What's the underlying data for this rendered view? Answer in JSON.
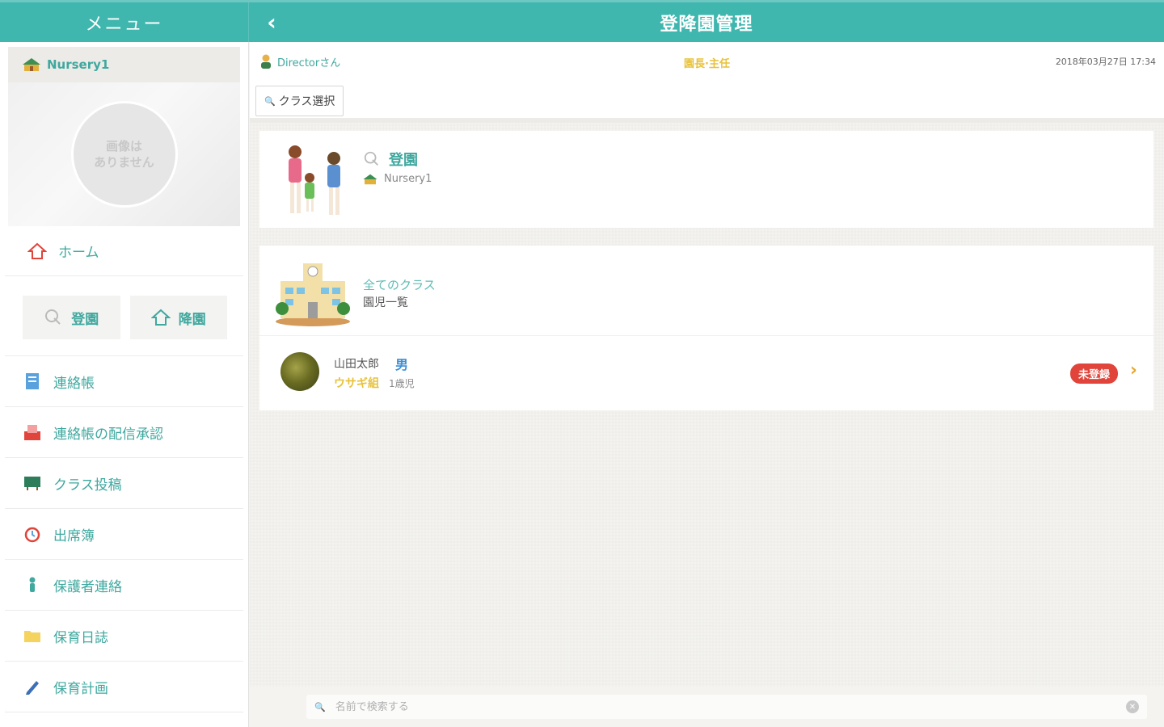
{
  "header": {
    "menu_title": "メニュー",
    "page_title": "登降園管理",
    "back_icon": "chevron-left-icon"
  },
  "sidebar": {
    "nursery_name": "Nursery1",
    "no_image_text": "画像は\nありません",
    "home_label": "ホーム",
    "attend_label": "登園",
    "leave_label": "降園",
    "items": [
      {
        "label": "連絡帳",
        "icon": "notebook-icon"
      },
      {
        "label": "連絡帳の配信承認",
        "icon": "approval-icon"
      },
      {
        "label": "クラス投稿",
        "icon": "board-icon"
      },
      {
        "label": "出席簿",
        "icon": "alarm-clock-icon"
      },
      {
        "label": "保護者連絡",
        "icon": "contact-icon"
      },
      {
        "label": "保育日誌",
        "icon": "folder-icon"
      },
      {
        "label": "保育計画",
        "icon": "pencil-icon"
      }
    ]
  },
  "infobar": {
    "user": "Directorさん",
    "role": "園長·主任",
    "datetime": "2018年03月27日 17:34"
  },
  "toolbar": {
    "class_select": "クラス選択"
  },
  "attend_card": {
    "title": "登園",
    "nursery": "Nursery1"
  },
  "class_card": {
    "title": "全てのクラス",
    "subtitle": "園児一覧"
  },
  "child": {
    "name": "山田太郎",
    "gender": "男",
    "class": "ウサギ組",
    "age": "1歳児",
    "status": "未登録"
  },
  "search": {
    "placeholder": "名前で検索する"
  },
  "colors": {
    "accent": "#3fb6ae",
    "status_red": "#e0443a",
    "highlight_yellow": "#e8c23a"
  }
}
